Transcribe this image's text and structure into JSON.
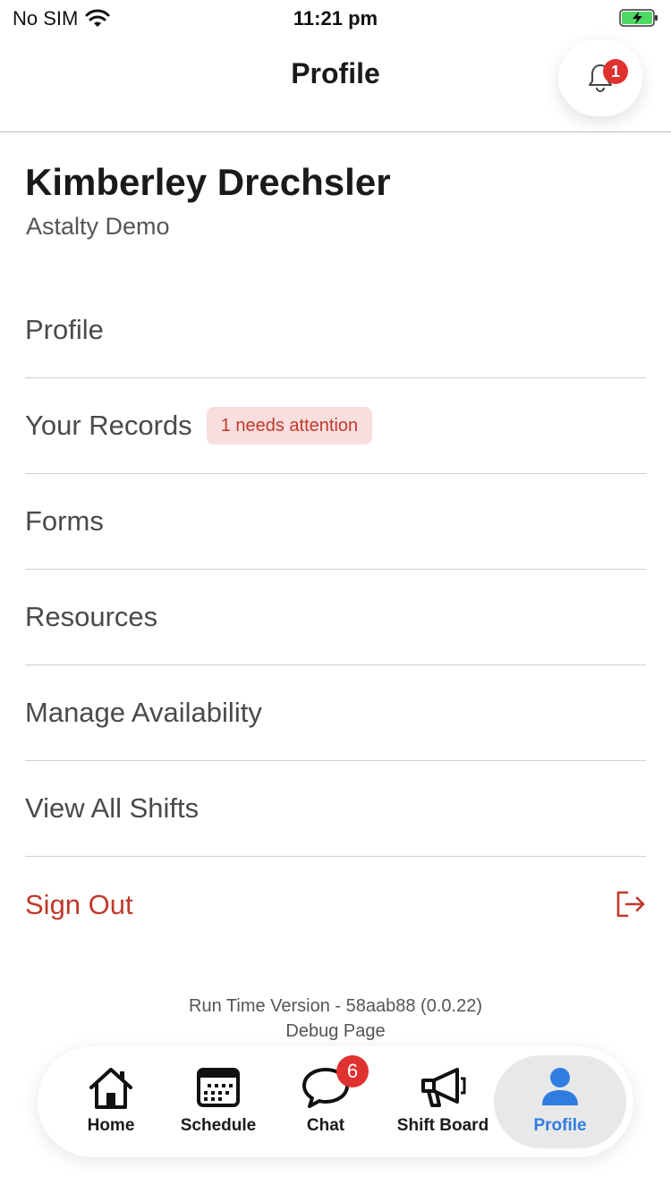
{
  "status_bar": {
    "carrier": "No SIM",
    "time": "11:21 pm"
  },
  "header": {
    "title": "Profile",
    "notification_count": "1"
  },
  "user": {
    "name": "Kimberley Drechsler",
    "organization": "Astalty Demo"
  },
  "menu": {
    "items": [
      {
        "label": "Profile"
      },
      {
        "label": "Your Records",
        "badge": "1 needs attention"
      },
      {
        "label": "Forms"
      },
      {
        "label": "Resources"
      },
      {
        "label": "Manage Availability"
      },
      {
        "label": "View All Shifts"
      }
    ],
    "sign_out": "Sign Out"
  },
  "footer": {
    "version": "Run Time Version - 58aab88 (0.0.22)",
    "debug": "Debug Page"
  },
  "tabbar": {
    "tabs": [
      {
        "label": "Home",
        "icon": "home-icon"
      },
      {
        "label": "Schedule",
        "icon": "calendar-icon"
      },
      {
        "label": "Chat",
        "icon": "chat-icon",
        "badge": "6"
      },
      {
        "label": "Shift Board",
        "icon": "megaphone-icon"
      },
      {
        "label": "Profile",
        "icon": "user-icon",
        "active": true
      }
    ]
  },
  "colors": {
    "accent": "#2f7de1",
    "danger": "#c0392b",
    "badge_red": "#e03131",
    "attention_bg": "#f8dede"
  }
}
